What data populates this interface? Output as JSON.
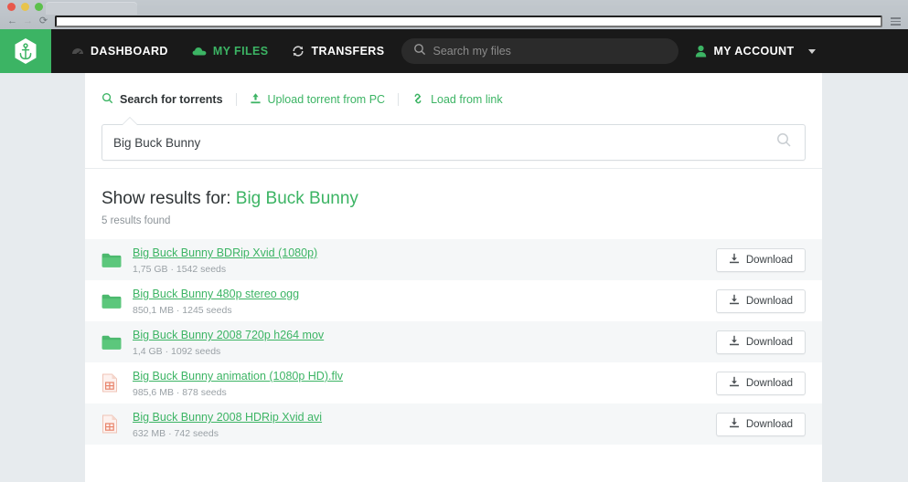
{
  "browser": {
    "back_icon": "back-arrow-icon",
    "forward_icon": "forward-arrow-icon",
    "reload_icon": "reload-icon",
    "url_value": "",
    "url_placeholder": "",
    "menu_icon": "hamburger-menu-icon"
  },
  "header": {
    "logo_icon": "anchor-hexagon-logo",
    "nav": [
      {
        "label": "DASHBOARD",
        "icon": "gauge-icon",
        "accent": false
      },
      {
        "label": "MY FILES",
        "icon": "cloud-icon",
        "accent": true
      },
      {
        "label": "TRANSFERS",
        "icon": "sync-icon",
        "accent": false
      }
    ],
    "search": {
      "placeholder": "Search my files",
      "value": "",
      "icon": "search-icon"
    },
    "account": {
      "label": "MY ACCOUNT",
      "icon": "user-icon",
      "caret": "chevron-down-icon"
    }
  },
  "search_panel": {
    "tabs": [
      {
        "label": "Search for torrents",
        "icon": "search-icon",
        "active": true
      },
      {
        "label": "Upload torrent from PC",
        "icon": "upload-icon",
        "active": false
      },
      {
        "label": "Load from link",
        "icon": "link-icon",
        "active": false
      }
    ],
    "input": {
      "value": "Big Buck Bunny",
      "placeholder": "Search for torrents",
      "icon": "search-icon"
    }
  },
  "results": {
    "title_prefix": "Show results for:",
    "query": "Big Buck Bunny",
    "count_text": "5 results found",
    "download_label": "Download",
    "download_icon": "download-icon",
    "items": [
      {
        "title": "Big Buck Bunny BDRip Xvid (1080p)",
        "size": "1,75 GB",
        "seeds": "1542 seeds",
        "meta": "1,75 GB · 1542 seeds",
        "icon": "folder-icon"
      },
      {
        "title": "Big Buck Bunny 480p stereo ogg",
        "size": "850,1 MB",
        "seeds": "1245 seeds",
        "meta": "850,1 MB · 1245 seeds",
        "icon": "folder-icon"
      },
      {
        "title": "Big Buck Bunny 2008 720p h264 mov",
        "size": "1,4 GB",
        "seeds": "1092 seeds",
        "meta": "1,4 GB · 1092 seeds",
        "icon": "folder-icon"
      },
      {
        "title": "Big Buck Bunny animation (1080p HD).flv",
        "size": "985,6 MB",
        "seeds": "878 seeds",
        "meta": "985,6 MB · 878 seeds",
        "icon": "video-file-icon"
      },
      {
        "title": "Big Buck Bunny 2008 HDRip Xvid avi",
        "size": "632 MB",
        "seeds": "742 seeds",
        "meta": "632 MB · 742 seeds",
        "icon": "video-file-icon"
      }
    ]
  },
  "colors": {
    "brand_green": "#3cb464",
    "header_dark": "#191919",
    "page_bg": "#e7ebee",
    "row_alt": "#f5f7f8",
    "file_icon": "#e8846b"
  }
}
